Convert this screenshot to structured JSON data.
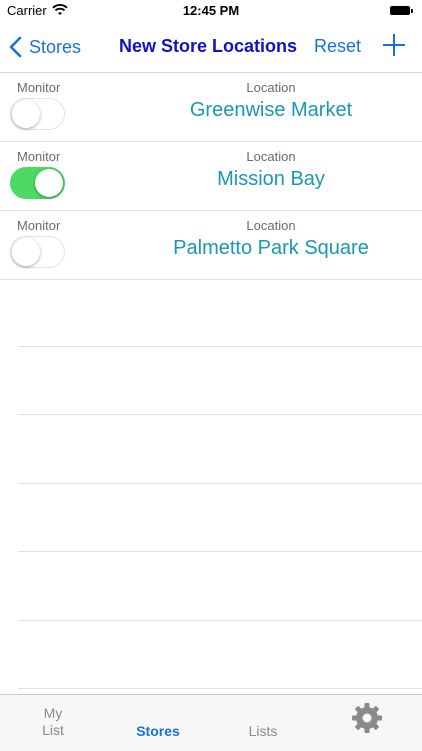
{
  "status_bar": {
    "carrier": "Carrier",
    "time": "12:45 PM"
  },
  "nav": {
    "back_label": "Stores",
    "title": "New Store Locations",
    "reset_label": "Reset",
    "add_icon": "plus-icon"
  },
  "rows": [
    {
      "monitor_label": "Monitor",
      "location_label": "Location",
      "location_name": "Greenwise Market",
      "monitor_on": false
    },
    {
      "monitor_label": "Monitor",
      "location_label": "Location",
      "location_name": "Mission Bay",
      "monitor_on": true
    },
    {
      "monitor_label": "Monitor",
      "location_label": "Location",
      "location_name": "Palmetto Park Square",
      "monitor_on": false
    }
  ],
  "tabs": {
    "my_list": "My\nList",
    "stores": "Stores",
    "lists": "Lists",
    "settings_icon": "gear-icon",
    "active": "stores"
  },
  "colors": {
    "accent": "#1a72d8",
    "title": "#1112c5",
    "location_text": "#1a97b4",
    "toggle_on": "#4cd964"
  }
}
